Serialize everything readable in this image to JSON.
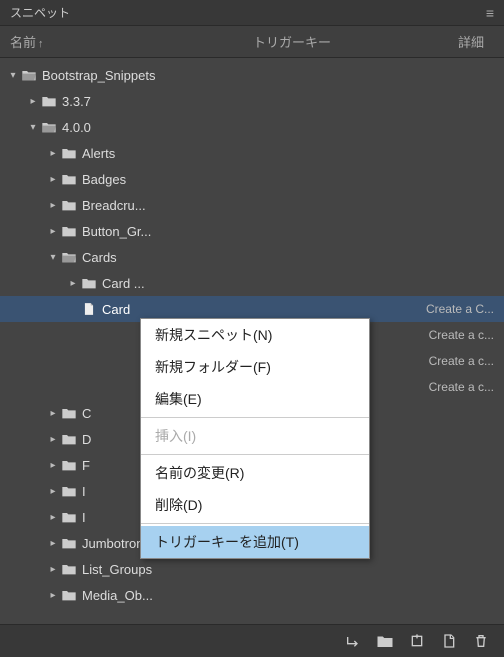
{
  "title": "スニペット",
  "columns": {
    "name": "名前",
    "trigger": "トリガーキー",
    "detail": "詳細"
  },
  "tree": {
    "root": {
      "label": "Bootstrap_Snippets"
    },
    "v337": {
      "label": "3.3.7"
    },
    "v400": {
      "label": "4.0.0"
    },
    "alerts": {
      "label": "Alerts"
    },
    "badges": {
      "label": "Badges"
    },
    "breadcru": {
      "label": "Breadcru..."
    },
    "buttongr": {
      "label": "Button_Gr..."
    },
    "cards": {
      "label": "Cards"
    },
    "cardfolder": {
      "label": "Card ..."
    },
    "card_sel": {
      "label": "Card",
      "detail": "Create a C..."
    },
    "row1": {
      "label": "",
      "detail": "Create a c..."
    },
    "row2": {
      "label": "",
      "detail": "Create a c..."
    },
    "row3": {
      "label": "",
      "detail": "Create a c..."
    },
    "c_folder": {
      "label": "C"
    },
    "d_folder": {
      "label": "D"
    },
    "f_folder": {
      "label": "F"
    },
    "i_folder": {
      "label": "I"
    },
    "i2_folder": {
      "label": "I"
    },
    "jumbotron": {
      "label": "Jumbotron"
    },
    "listgroups": {
      "label": "List_Groups"
    },
    "mediaob": {
      "label": "Media_Ob..."
    }
  },
  "contextMenu": {
    "newSnippet": "新規スニペット(N)",
    "newFolder": "新規フォルダー(F)",
    "edit": "編集(E)",
    "insert": "挿入(I)",
    "rename": "名前の変更(R)",
    "delete": "削除(D)",
    "addTrigger": "トリガーキーを追加(T)"
  }
}
